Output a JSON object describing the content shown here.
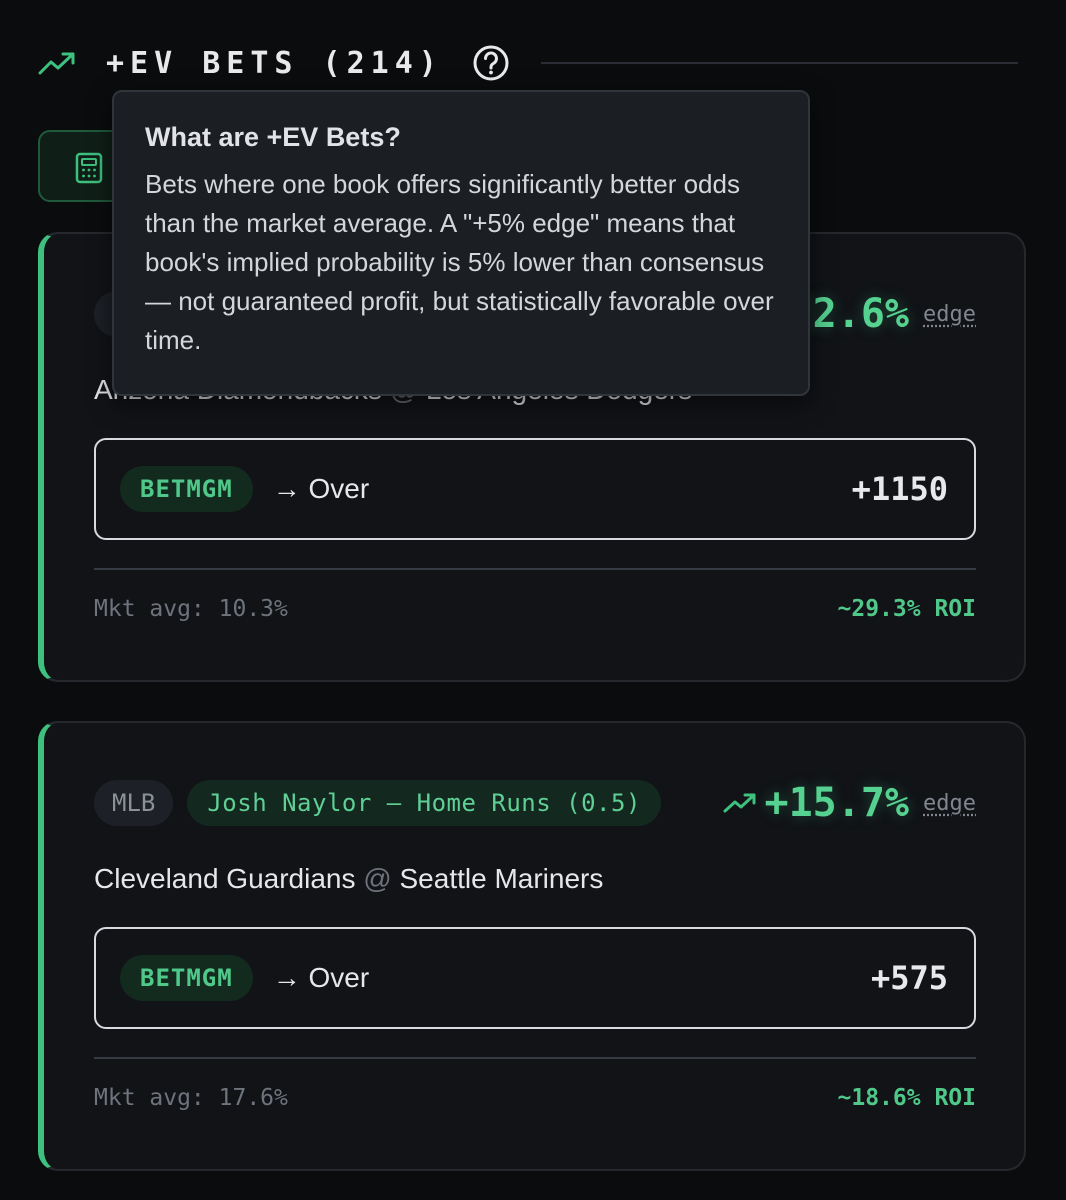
{
  "header": {
    "icon": "trending-up-icon",
    "title": "+EV BETS (214)",
    "help_icon": "question-circle-icon"
  },
  "toolbar": {
    "calculator_icon": "calculator-icon"
  },
  "tooltip": {
    "title": "What are +EV Bets?",
    "body": "Bets where one book offers significantly better odds than the market average. A \"+5% edge\" means that book's implied probability is 5% lower than consensus — not guaranteed profit, but statistically favorable over time."
  },
  "cards": [
    {
      "edge": "+22.6%",
      "edge_label": "edge",
      "matchup_away": "Arizona Diamondbacks",
      "matchup_at": "@",
      "matchup_home": "Los Angeles Dodgers",
      "book": "BETMGM",
      "pick": "→ Over",
      "odds": "+1150",
      "mkt_avg": "Mkt avg: 10.3%",
      "roi": "~29.3% ROI"
    },
    {
      "league": "MLB",
      "market": "Josh Naylor — Home Runs (0.5)",
      "edge": "+15.7%",
      "edge_label": "edge",
      "matchup_away": "Cleveland Guardians",
      "matchup_at": "@",
      "matchup_home": "Seattle Mariners",
      "book": "BETMGM",
      "pick": "→ Over",
      "odds": "+575",
      "mkt_avg": "Mkt avg: 17.6%",
      "roi": "~18.6% ROI"
    }
  ],
  "colors": {
    "accent": "#3ec07f",
    "background": "#0b0c0e",
    "card": "#111317",
    "tooltip": "#1b1e23"
  }
}
